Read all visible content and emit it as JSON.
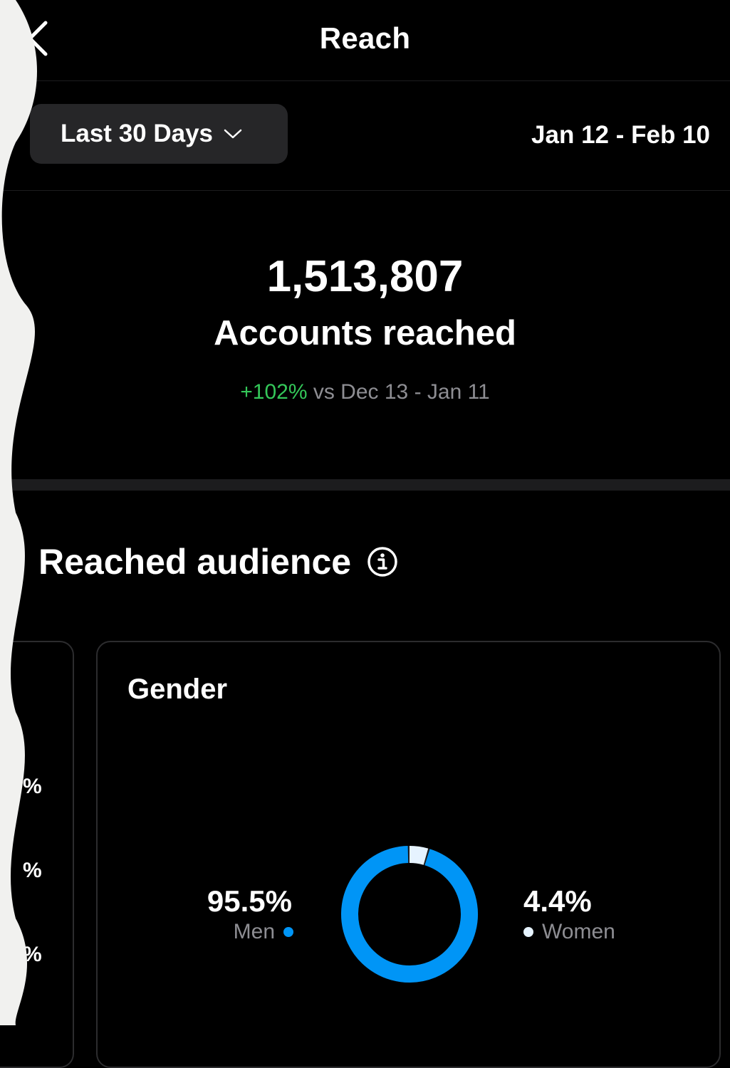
{
  "header": {
    "title": "Reach",
    "back_icon": "chevron-left-icon"
  },
  "filter": {
    "range_label": "Last 30 Days",
    "chevron_icon": "chevron-down-icon",
    "date_range": "Jan 12 - Feb 10"
  },
  "summary": {
    "value": "1,513,807",
    "label": "Accounts reached",
    "change": "+102%",
    "compare_text": "vs Dec 13 - Jan 11"
  },
  "audience": {
    "title": "Reached audience",
    "info_icon": "info-icon",
    "left_card_pcts": [
      "%",
      "%",
      "%"
    ],
    "gender": {
      "title": "Gender",
      "men": {
        "value": "95.5%",
        "label": "Men",
        "fraction": 0.955,
        "color": "#0095f6"
      },
      "women": {
        "value": "4.4%",
        "label": "Women",
        "fraction": 0.044,
        "color": "#e6f3ff"
      }
    }
  },
  "colors": {
    "accent": "#0095f6",
    "positive": "#34c759",
    "muted": "#8e8e93",
    "page_edge": "#f1f1ef"
  }
}
